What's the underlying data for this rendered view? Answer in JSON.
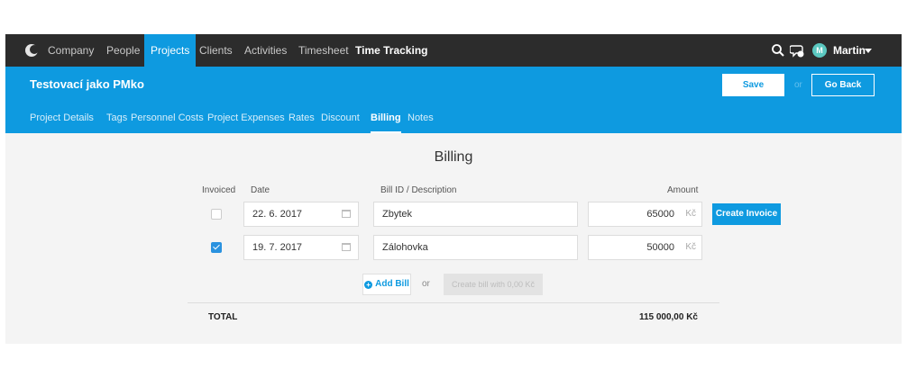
{
  "nav": {
    "items": [
      {
        "label": "Company"
      },
      {
        "label": "People"
      },
      {
        "label": "Projects",
        "active": true
      },
      {
        "label": "Clients"
      },
      {
        "label": "Activities"
      },
      {
        "label": "Timesheet"
      },
      {
        "label": "Time Tracking"
      }
    ],
    "user": {
      "initial": "M",
      "name": "Martin"
    },
    "icons": [
      "logo-icon",
      "search-icon",
      "chat-icon",
      "chevron-down-icon"
    ]
  },
  "project": {
    "title": "Testovací jako PMko",
    "save_label": "Save",
    "or_label": "or",
    "back_label": "Go Back",
    "tabs": [
      {
        "label": "Project Details"
      },
      {
        "label": "Tags"
      },
      {
        "label": "Personnel Costs"
      },
      {
        "label": "Project Expenses"
      },
      {
        "label": "Rates"
      },
      {
        "label": "Discount"
      },
      {
        "label": "Billing",
        "active": true
      },
      {
        "label": "Notes"
      }
    ]
  },
  "billing": {
    "title": "Billing",
    "columns": {
      "invoiced": "Invoiced",
      "date": "Date",
      "description": "Bill ID / Description",
      "amount": "Amount"
    },
    "rows": [
      {
        "invoiced": false,
        "date": "22. 6. 2017",
        "description": "Zbytek",
        "amount": "65000",
        "currency": "Kč",
        "action": "Create Invoice"
      },
      {
        "invoiced": true,
        "date": "19. 7. 2017",
        "description": "Zálohovka",
        "amount": "50000",
        "currency": "Kč"
      }
    ],
    "add_bill_label": "Add Bill",
    "or_label": "or",
    "create_bill_label": "Create bill with 0,00 Kč",
    "total_label": "TOTAL",
    "total_value": "115 000,00 Kč"
  },
  "colors": {
    "accent": "#0e9ae0",
    "nav_bg": "#2c2c2c",
    "page_bg": "#f4f4f4"
  }
}
